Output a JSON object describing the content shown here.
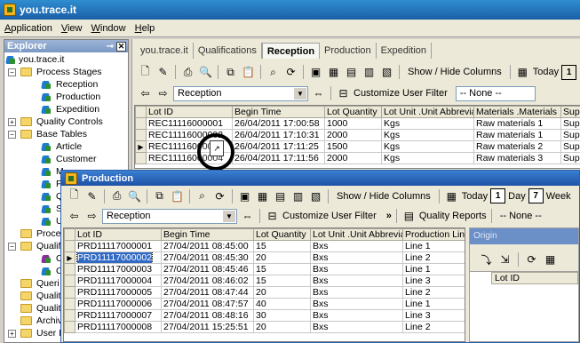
{
  "app": {
    "title": "you.trace.it"
  },
  "menu": [
    "Application",
    "View",
    "Window",
    "Help"
  ],
  "explorer": {
    "title": "Explorer",
    "root": "you.trace.it",
    "nodes": {
      "process_stages": "Process Stages",
      "reception": "Reception",
      "production": "Production",
      "expedition": "Expedition",
      "quality_controls": "Quality Controls",
      "base_tables": "Base Tables",
      "article": "Article",
      "customer": "Customer",
      "m": "M",
      "p": "P",
      "q": "Q",
      "s": "S",
      "u": "U",
      "proce": "Proce",
      "qualif": "Qualif",
      "c1": "C",
      "c2": "C",
      "queri": "Queri",
      "qualit1": "Qualit",
      "qualit2": "Qualit",
      "archiv": "Archiv",
      "user": "User I"
    }
  },
  "tabs": [
    "you.trace.it",
    "Qualifications",
    "Reception",
    "Production",
    "Expedition"
  ],
  "reception_toolbar": {
    "show_hide": "Show / Hide Columns",
    "today": "Today",
    "day_num": "1",
    "stage_select": "Reception",
    "customize": "Customize User Filter",
    "filter_select": "-- None --"
  },
  "reception_grid": {
    "columns": [
      "Lot ID",
      "Begin Time",
      "Lot Quantity",
      "Lot Unit .Unit Abbreviation",
      "Materials .Materials",
      "Supp"
    ],
    "rows": [
      [
        "REC11116000001",
        "26/04/2011 17:00:58",
        "1000",
        "Kgs",
        "Raw materials 1",
        "Supp"
      ],
      [
        "REC11116000002",
        "26/04/2011 17:10:31",
        "2000",
        "Kgs",
        "Raw materials 1",
        "Supp"
      ],
      [
        "REC11116000003",
        "26/04/2011 17:11:25",
        "1500",
        "Kgs",
        "Raw materials 2",
        "Supp"
      ],
      [
        "REC11116000004",
        "26/04/2011 17:11:56",
        "2000",
        "Kgs",
        "Raw materials 3",
        "Supp"
      ]
    ]
  },
  "production_window": {
    "title": "Production",
    "show_hide": "Show / Hide Columns",
    "today": "Today",
    "day": "Day",
    "day_num": "1",
    "week": "Week",
    "week_num": "7",
    "stage_select": "Reception",
    "customize": "Customize User Filter",
    "more": "»",
    "quality_reports": "Quality Reports",
    "filter_select": "-- None --",
    "origin_label": "Origin",
    "origin_col": "Lot ID",
    "columns": [
      "Lot ID",
      "Begin Time",
      "Lot Quantity",
      "Lot Unit .Unit Abbreviation",
      "Production Line"
    ],
    "rows": [
      [
        "PRD11117000001",
        "27/04/2011 08:45:00",
        "15",
        "Bxs",
        "Line 1"
      ],
      [
        "PRD11117000002",
        "27/04/2011 08:45:30",
        "20",
        "Bxs",
        "Line 2"
      ],
      [
        "PRD11117000003",
        "27/04/2011 08:45:46",
        "15",
        "Bxs",
        "Line 1"
      ],
      [
        "PRD11117000004",
        "27/04/2011 08:46:02",
        "15",
        "Bxs",
        "Line 3"
      ],
      [
        "PRD11117000005",
        "27/04/2011 08:47:44",
        "20",
        "Bxs",
        "Line 2"
      ],
      [
        "PRD11117000006",
        "27/04/2011 08:47:57",
        "40",
        "Bxs",
        "Line 1"
      ],
      [
        "PRD11117000007",
        "27/04/2011 08:48:16",
        "30",
        "Bxs",
        "Line 3"
      ],
      [
        "PRD11117000008",
        "27/04/2011 15:25:51",
        "20",
        "Bxs",
        "Line 2"
      ]
    ]
  },
  "colors": {
    "title_blue": "#1d52a6",
    "selection": "#316ac5",
    "folder": "#f4d56a"
  }
}
